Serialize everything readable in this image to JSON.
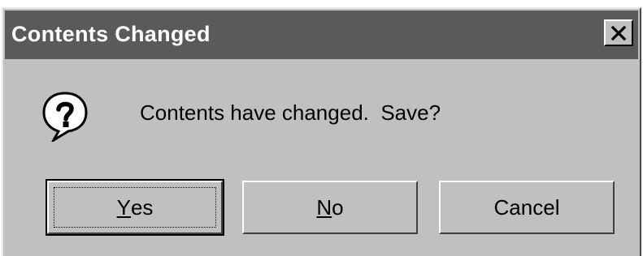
{
  "window": {
    "title": "Contents Changed",
    "close_icon": "close-icon"
  },
  "message": {
    "icon": "question-icon",
    "text": "Contents have changed.  Save?"
  },
  "buttons": {
    "yes": {
      "mnemonic": "Y",
      "rest": "es",
      "default": true
    },
    "no": {
      "mnemonic": "N",
      "rest": "o"
    },
    "cancel": {
      "label": "Cancel"
    }
  },
  "colors": {
    "titlebar": "#5a5a5a",
    "face": "#c0c0c0",
    "text": "#000000"
  }
}
